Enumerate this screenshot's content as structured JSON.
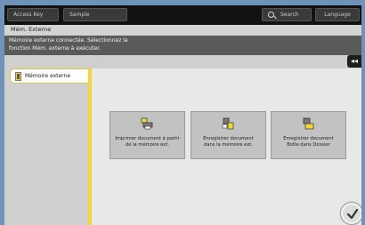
{
  "topbar": {
    "access_label": "Access Key",
    "sample_label": "Sample",
    "search_label": "Search",
    "language_label": "Language"
  },
  "title": "Mém. Externe",
  "message": {
    "line1": "Mémoire externe connectée. Sélectionnez la",
    "line2": "fonction Mém. externe à exécuter."
  },
  "sidebar": {
    "tab_label": "Mémoire externe",
    "tab_icon": "usb-memory-icon"
  },
  "collapse_label": "◂◂",
  "functions": [
    {
      "line1": "Imprimer document à partir",
      "line2": "de la mémoire ext.",
      "icon": "print-from-memory-icon"
    },
    {
      "line1": "Enregistrer document",
      "line2": "dans la mémoire ext.",
      "icon": "save-to-memory-icon"
    },
    {
      "line1": "Enregistrer document",
      "line2": "Boîte dans Dossier",
      "icon": "box-to-folder-icon"
    }
  ],
  "ok_icon": "checkmark-icon",
  "colors": {
    "accent_yellow": "#f3d534",
    "frame_blue": "#6f93b8",
    "screen_black": "#0f0f0f"
  }
}
